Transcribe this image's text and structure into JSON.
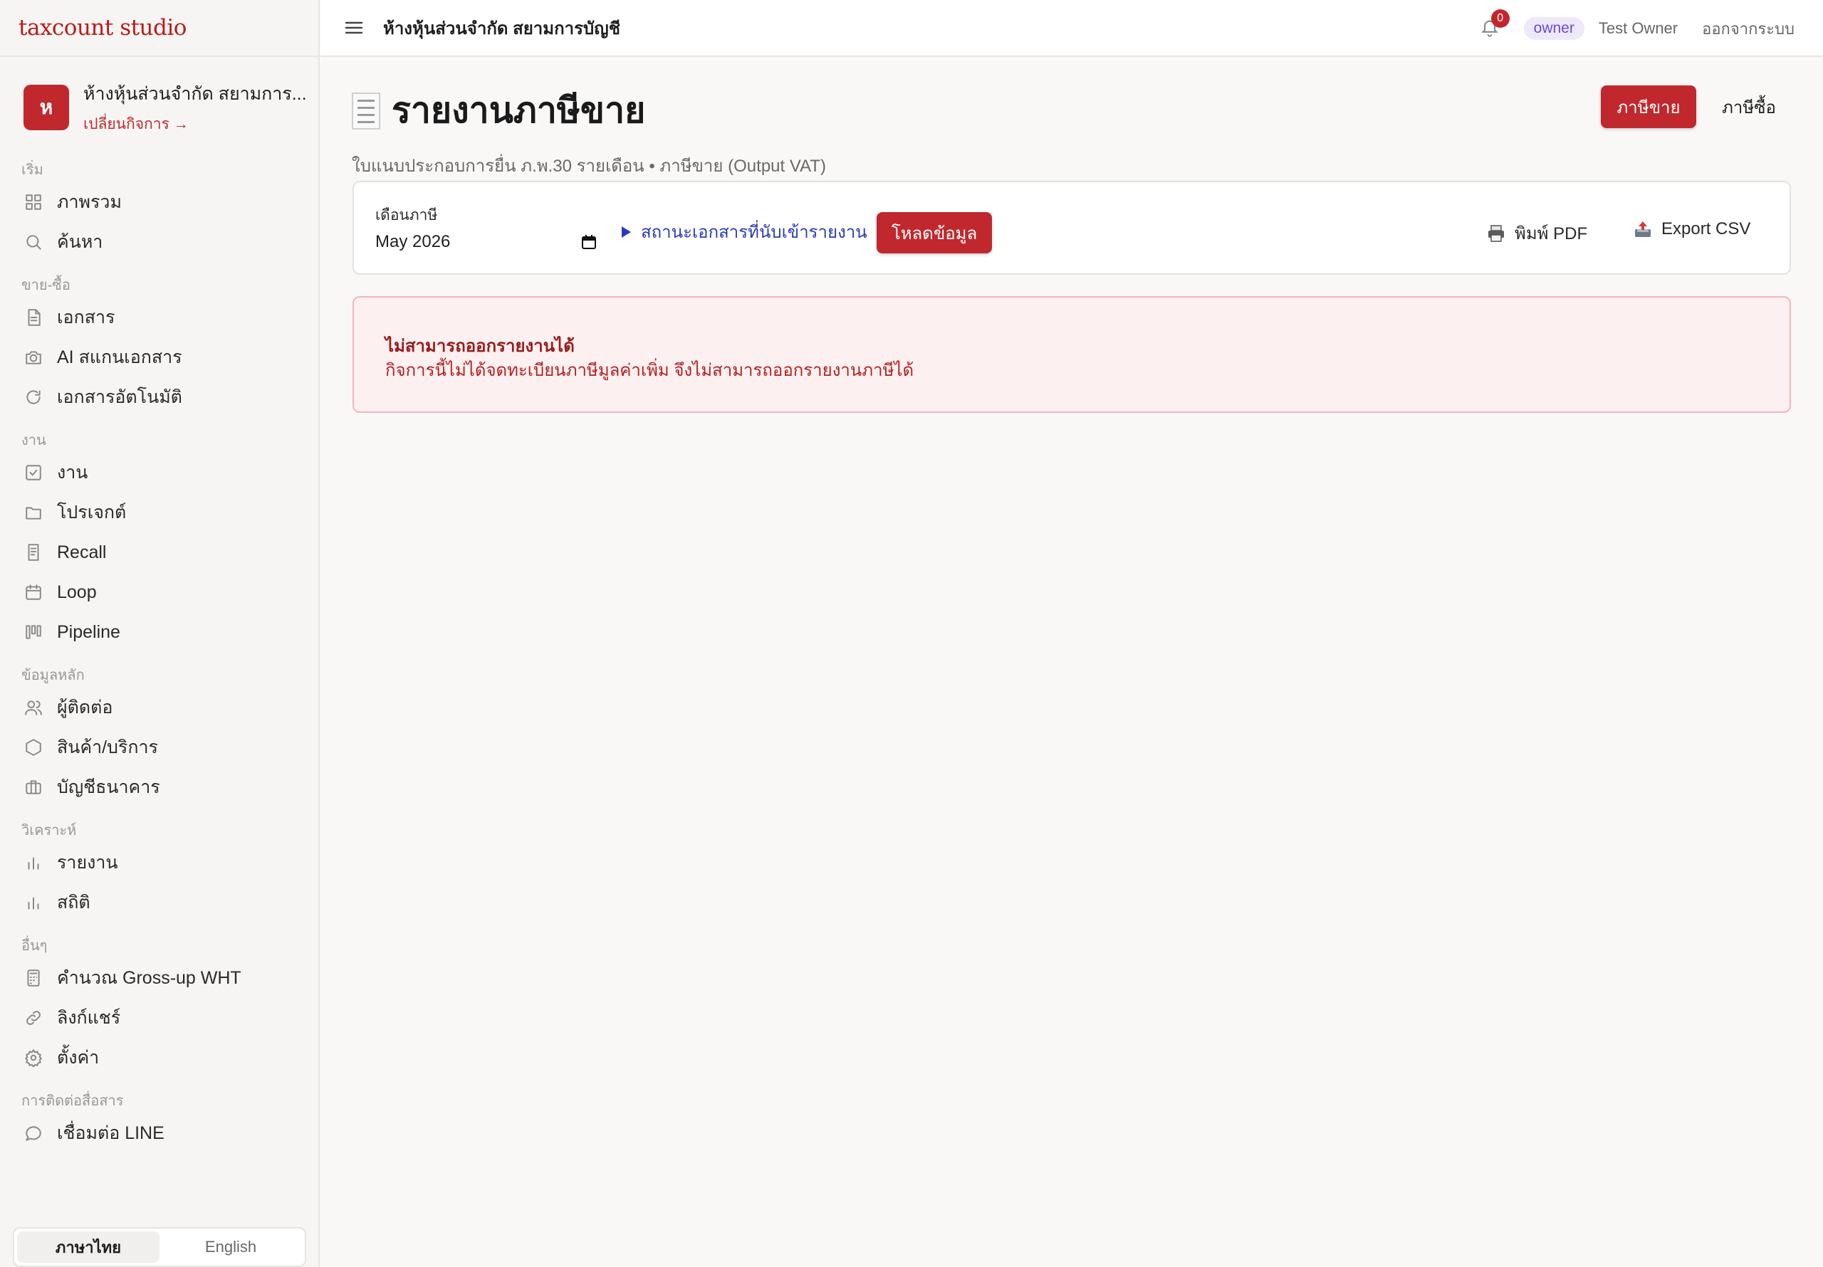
{
  "app": {
    "brand": "taxcount studio"
  },
  "company": {
    "avatar_letter": "ห",
    "name": "ห้างหุ้นส่วนจำกัด สยามการ...",
    "switch_label": "เปลี่ยนกิจการ →"
  },
  "sidebar": {
    "sections": [
      {
        "title": "เริ่ม",
        "items": [
          {
            "label": "ภาพรวม",
            "icon": "grid-icon"
          },
          {
            "label": "ค้นหา",
            "icon": "search-icon"
          }
        ]
      },
      {
        "title": "ขาย-ซื้อ",
        "items": [
          {
            "label": "เอกสาร",
            "icon": "document-icon"
          },
          {
            "label": "AI สแกนเอกสาร",
            "icon": "camera-icon"
          },
          {
            "label": "เอกสารอัตโนมัติ",
            "icon": "refresh-icon"
          }
        ]
      },
      {
        "title": "งาน",
        "items": [
          {
            "label": "งาน",
            "icon": "checkbox-icon"
          },
          {
            "label": "โปรเจกต์",
            "icon": "folder-icon"
          },
          {
            "label": "Recall",
            "icon": "receipt-icon"
          },
          {
            "label": "Loop",
            "icon": "calendar-icon"
          },
          {
            "label": "Pipeline",
            "icon": "kanban-icon"
          }
        ]
      },
      {
        "title": "ข้อมูลหลัก",
        "items": [
          {
            "label": "ผู้ติดต่อ",
            "icon": "users-icon"
          },
          {
            "label": "สินค้า/บริการ",
            "icon": "box-icon"
          },
          {
            "label": "บัญชีธนาคาร",
            "icon": "briefcase-icon"
          }
        ]
      },
      {
        "title": "วิเคราะห์",
        "items": [
          {
            "label": "รายงาน",
            "icon": "bar-chart-icon"
          },
          {
            "label": "สถิติ",
            "icon": "bar-chart-icon"
          }
        ]
      },
      {
        "title": "อื่นๆ",
        "items": [
          {
            "label": "คำนวณ Gross-up WHT",
            "icon": "calculator-icon"
          },
          {
            "label": "ลิงก์แชร์",
            "icon": "link-icon"
          },
          {
            "label": "ตั้งค่า",
            "icon": "gear-icon"
          }
        ]
      },
      {
        "title": "การติดต่อสื่อสาร",
        "items": [
          {
            "label": "เชื่อมต่อ LINE",
            "icon": "chat-icon"
          }
        ]
      }
    ]
  },
  "language": {
    "thai": "ภาษาไทย",
    "english": "English",
    "active": "thai"
  },
  "topbar": {
    "title": "ห้างหุ้นส่วนจำกัด สยามการบัญชี",
    "notification_count": "0",
    "role": "owner",
    "user_name": "Test Owner",
    "logout": "ออกจากระบบ"
  },
  "page": {
    "title": "รายงานภาษีขาย",
    "subtitle": "ใบแนบประกอบการยื่น ภ.พ.30 รายเดือน • ภาษีขาย (Output VAT)",
    "tab_sale": "ภาษีขาย",
    "tab_purchase": "ภาษีซื้อ"
  },
  "filters": {
    "month_label": "เดือนภาษี",
    "month_value": "May  2026",
    "doc_status_toggle": "สถานะเอกสารที่นับเข้ารายงาน",
    "load_button": "โหลดข้อมูล",
    "print_pdf": "พิมพ์ PDF",
    "export_csv": "Export CSV"
  },
  "alert": {
    "title": "ไม่สามารถออกรายงานได้",
    "message": "กิจการนี้ไม่ได้จดทะเบียนภาษีมูลค่าเพิ่ม จึงไม่สามารถออกรายงานภาษีได้"
  },
  "colors": {
    "accent": "#c0282d",
    "alert_bg": "#fdf0f1",
    "link": "#2a3bb8",
    "role_badge": "#6d4ad1"
  }
}
